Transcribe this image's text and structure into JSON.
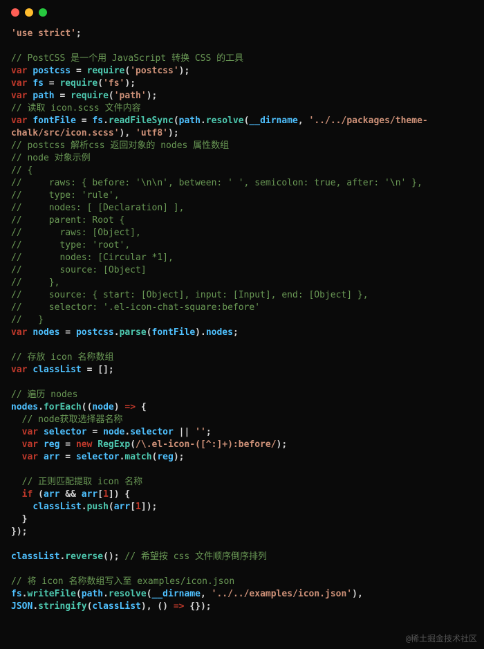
{
  "watermark": "@稀土掘金技术社区",
  "code_lines": [
    {
      "t": "raw",
      "html": "<span class='str'>'use strict'</span><span class='p'>;</span>"
    },
    {
      "t": "blank"
    },
    {
      "t": "cm",
      "text": "// PostCSS 是一个用 JavaScript 转换 CSS 的工具"
    },
    {
      "t": "raw",
      "html": "<span class='kw'>var</span> <span class='var'>postcss</span> <span class='p'>=</span> <span class='fn'>require</span><span class='p'>(</span><span class='str'>'postcss'</span><span class='p'>);</span>"
    },
    {
      "t": "raw",
      "html": "<span class='kw'>var</span> <span class='var'>fs</span> <span class='p'>=</span> <span class='fn'>require</span><span class='p'>(</span><span class='str'>'fs'</span><span class='p'>);</span>"
    },
    {
      "t": "raw",
      "html": "<span class='kw'>var</span> <span class='var'>path</span> <span class='p'>=</span> <span class='fn'>require</span><span class='p'>(</span><span class='str'>'path'</span><span class='p'>);</span>"
    },
    {
      "t": "cm",
      "text": "// 读取 icon.scss 文件内容"
    },
    {
      "t": "raw",
      "html": "<span class='kw'>var</span> <span class='var'>fontFile</span> <span class='p'>=</span> <span class='var'>fs</span><span class='p'>.</span><span class='fn'>readFileSync</span><span class='p'>(</span><span class='var'>path</span><span class='p'>.</span><span class='fn'>resolve</span><span class='p'>(</span><span class='var'>__dirname</span><span class='p'>,</span> <span class='str'>'../../packages/theme-</span>"
    },
    {
      "t": "raw",
      "html": "<span class='str'>chalk/src/icon.scss'</span><span class='p'>),</span> <span class='str'>'utf8'</span><span class='p'>);</span>"
    },
    {
      "t": "cm",
      "text": "// postcss 解析css 返回对象的 nodes 属性数组"
    },
    {
      "t": "cm",
      "text": "// node 对象示例"
    },
    {
      "t": "cm",
      "text": "// {"
    },
    {
      "t": "cm",
      "text": "//     raws: { before: '\\n\\n', between: ' ', semicolon: true, after: '\\n' },"
    },
    {
      "t": "cm",
      "text": "//     type: 'rule',"
    },
    {
      "t": "cm",
      "text": "//     nodes: [ [Declaration] ],"
    },
    {
      "t": "cm",
      "text": "//     parent: Root {"
    },
    {
      "t": "cm",
      "text": "//       raws: [Object],"
    },
    {
      "t": "cm",
      "text": "//       type: 'root',"
    },
    {
      "t": "cm",
      "text": "//       nodes: [Circular *1],"
    },
    {
      "t": "cm",
      "text": "//       source: [Object]"
    },
    {
      "t": "cm",
      "text": "//     },"
    },
    {
      "t": "cm",
      "text": "//     source: { start: [Object], input: [Input], end: [Object] },"
    },
    {
      "t": "cm",
      "text": "//     selector: '.el-icon-chat-square:before'"
    },
    {
      "t": "cm",
      "text": "//   }"
    },
    {
      "t": "raw",
      "html": "<span class='kw'>var</span> <span class='var'>nodes</span> <span class='p'>=</span> <span class='var'>postcss</span><span class='p'>.</span><span class='fn'>parse</span><span class='p'>(</span><span class='var'>fontFile</span><span class='p'>).</span><span class='var'>nodes</span><span class='p'>;</span>"
    },
    {
      "t": "blank"
    },
    {
      "t": "cm",
      "text": "// 存放 icon 名称数组"
    },
    {
      "t": "raw",
      "html": "<span class='kw'>var</span> <span class='var'>classList</span> <span class='p'>= [];</span>"
    },
    {
      "t": "blank"
    },
    {
      "t": "cm",
      "text": "// 遍历 nodes"
    },
    {
      "t": "raw",
      "html": "<span class='var'>nodes</span><span class='p'>.</span><span class='fn'>forEach</span><span class='p'>((</span><span class='var'>node</span><span class='p'>)</span> <span class='kw'>=></span> <span class='p'>{</span>"
    },
    {
      "t": "raw",
      "html": "  <span class='cm'>// node获取选择器名称</span>"
    },
    {
      "t": "raw",
      "html": "  <span class='kw'>var</span> <span class='var'>selector</span> <span class='p'>=</span> <span class='var'>node</span><span class='p'>.</span><span class='var'>selector</span> <span class='p'>||</span> <span class='str'>''</span><span class='p'>;</span>"
    },
    {
      "t": "raw",
      "html": "  <span class='kw'>var</span> <span class='var'>reg</span> <span class='p'>=</span> <span class='kw'>new</span> <span class='fn'>RegExp</span><span class='p'>(</span><span class='str'>/\\.el-icon-([^:]+):before/</span><span class='p'>);</span>"
    },
    {
      "t": "raw",
      "html": "  <span class='kw'>var</span> <span class='var'>arr</span> <span class='p'>=</span> <span class='var'>selector</span><span class='p'>.</span><span class='fn'>match</span><span class='p'>(</span><span class='var'>reg</span><span class='p'>);</span>"
    },
    {
      "t": "blank"
    },
    {
      "t": "raw",
      "html": "  <span class='cm'>// 正则匹配提取 icon 名称</span>"
    },
    {
      "t": "raw",
      "html": "  <span class='kw'>if</span> <span class='p'>(</span><span class='var'>arr</span> <span class='p'>&amp;&amp;</span> <span class='var'>arr</span><span class='p'>[</span><span class='num'>1</span><span class='p'>]) {</span>"
    },
    {
      "t": "raw",
      "html": "    <span class='var'>classList</span><span class='p'>.</span><span class='fn'>push</span><span class='p'>(</span><span class='var'>arr</span><span class='p'>[</span><span class='num'>1</span><span class='p'>]);</span>"
    },
    {
      "t": "raw",
      "html": "  <span class='p'>}</span>"
    },
    {
      "t": "raw",
      "html": "<span class='p'>});</span>"
    },
    {
      "t": "blank"
    },
    {
      "t": "raw",
      "html": "<span class='var'>classList</span><span class='p'>.</span><span class='fn'>reverse</span><span class='p'>();</span> <span class='cm'>// 希望按 css 文件顺序倒序排列</span>"
    },
    {
      "t": "blank"
    },
    {
      "t": "cm",
      "text": "// 将 icon 名称数组写入至 examples/icon.json"
    },
    {
      "t": "raw",
      "html": "<span class='var'>fs</span><span class='p'>.</span><span class='fn'>writeFile</span><span class='p'>(</span><span class='var'>path</span><span class='p'>.</span><span class='fn'>resolve</span><span class='p'>(</span><span class='var'>__dirname</span><span class='p'>,</span> <span class='str'>'../../examples/icon.json'</span><span class='p'>),</span>"
    },
    {
      "t": "raw",
      "html": "<span class='var'>JSON</span><span class='p'>.</span><span class='fn'>stringify</span><span class='p'>(</span><span class='var'>classList</span><span class='p'>), ()</span> <span class='kw'>=></span> <span class='p'>{});</span>"
    }
  ]
}
